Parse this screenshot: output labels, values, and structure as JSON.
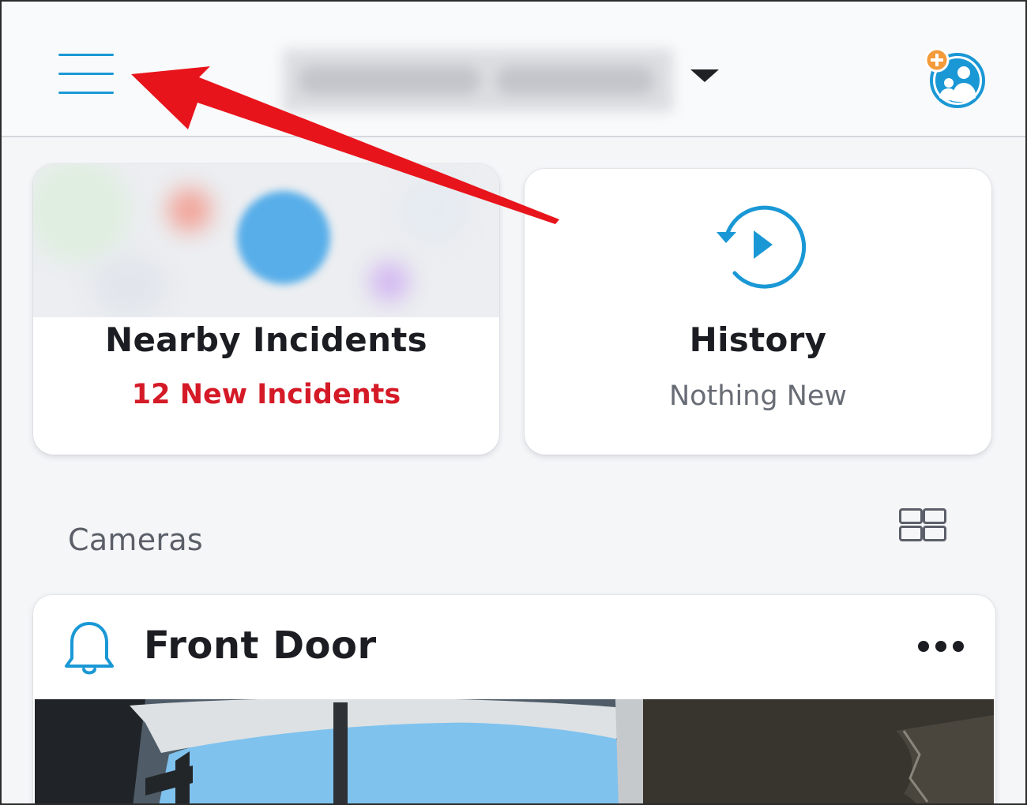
{
  "header": {
    "menu_icon": "hamburger-menu-icon",
    "location_selector": {
      "icon": "caret-down-icon"
    },
    "account_icon": "shared-users-add-icon",
    "colors": {
      "accent": "#1a98d5",
      "badge": "#f39a3a"
    }
  },
  "dashboard_tiles": [
    {
      "title": "Nearby Incidents",
      "subtitle": "12 New Incidents",
      "subtitle_color": "#d51a27"
    },
    {
      "title": "History",
      "subtitle": "Nothing New",
      "icon": "history-replay-icon",
      "subtitle_color": "#686c75"
    }
  ],
  "cameras_section": {
    "title": "Cameras",
    "view_toggle_icon": "grid-view-icon"
  },
  "cameras": [
    {
      "name": "Front Door",
      "icon": "doorbell-icon",
      "menu_icon": "more-options-icon"
    }
  ],
  "annotation": {
    "type": "arrow",
    "color": "#e8141b",
    "points_to": "hamburger-menu-icon"
  }
}
